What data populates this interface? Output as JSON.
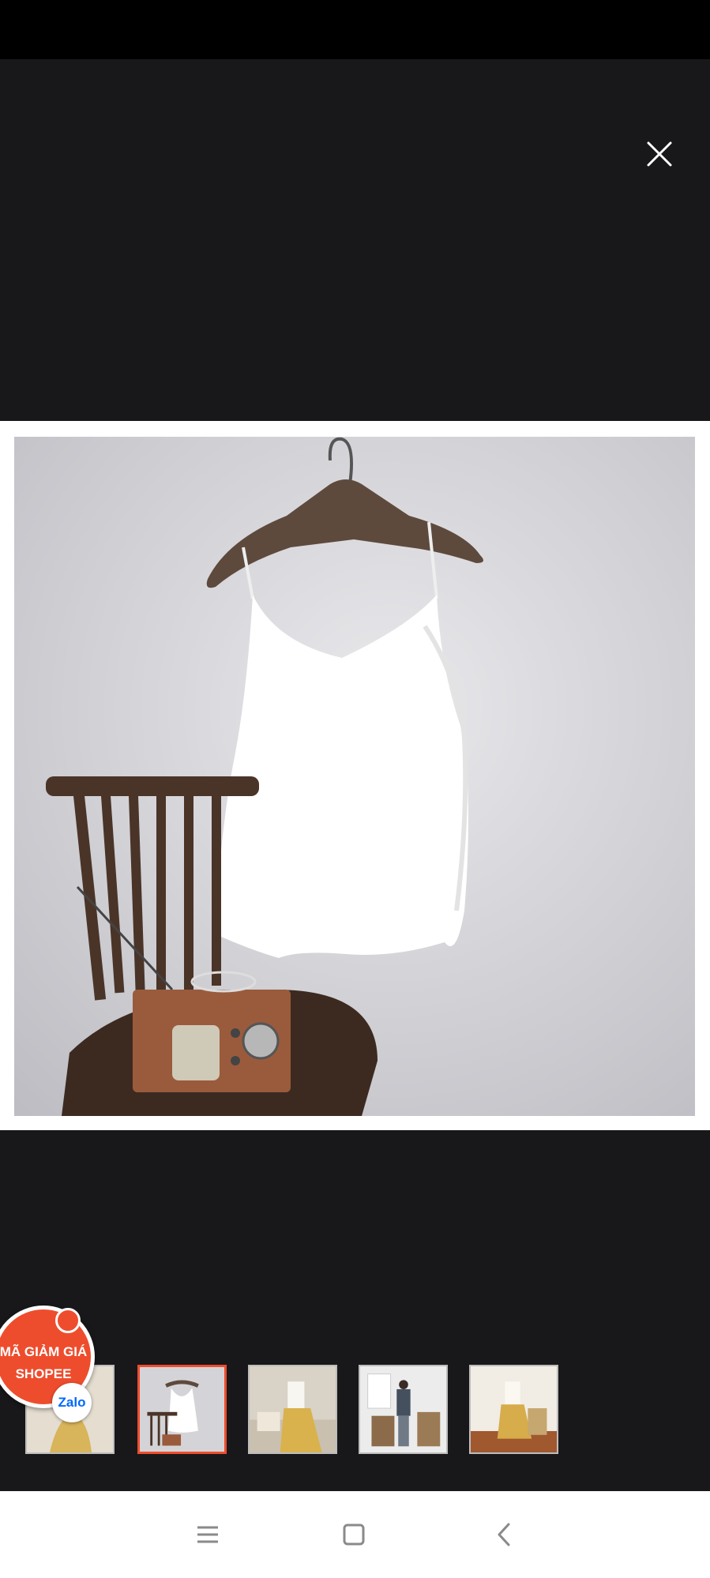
{
  "viewer": {
    "close_icon": "close-icon",
    "main_image": "white-v-neck-camisole-on-wooden-hanger",
    "active_thumbnail_index": 1
  },
  "thumbnails": [
    {
      "name": "thumbnail-1",
      "active": false
    },
    {
      "name": "thumbnail-2",
      "active": true
    },
    {
      "name": "thumbnail-3",
      "active": false
    },
    {
      "name": "thumbnail-4",
      "active": false
    },
    {
      "name": "thumbnail-5",
      "active": false
    }
  ],
  "promo": {
    "line1": "MÃ GIẢM GIÁ",
    "line2": "SHOPEE",
    "zalo_label": "Zalo",
    "accent": "#ee4d2d"
  },
  "nav_bar": {
    "menu_icon": "menu-icon",
    "home_icon": "home-icon",
    "back_icon": "back-icon"
  }
}
